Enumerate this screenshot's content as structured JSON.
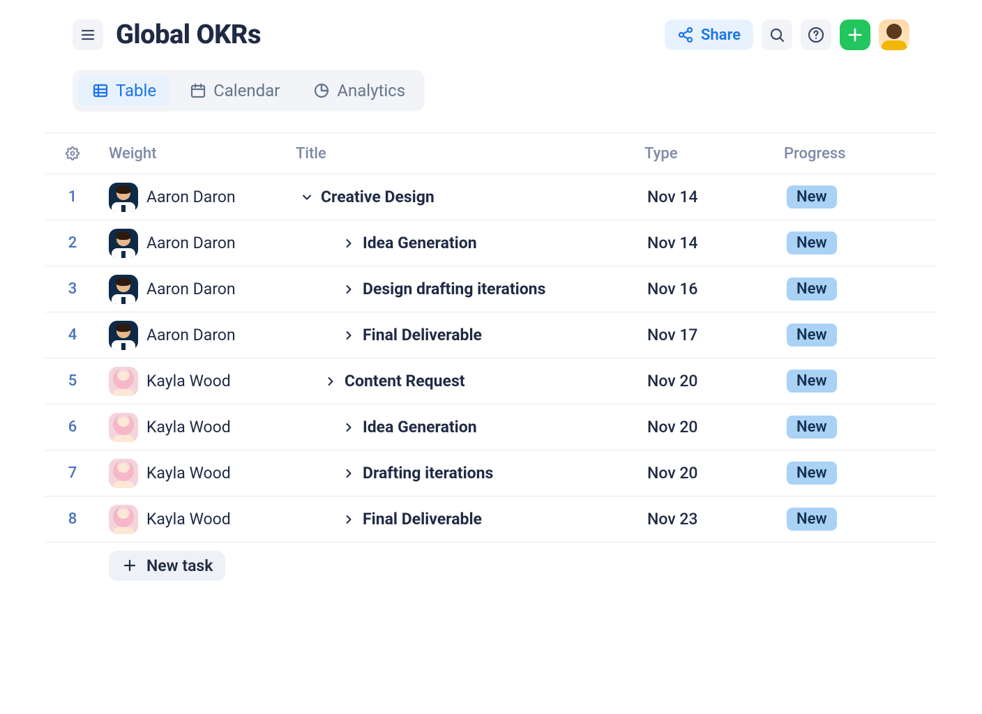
{
  "header": {
    "title": "Global OKRs",
    "share_label": "Share"
  },
  "tabs": [
    {
      "id": "table",
      "label": "Table",
      "icon": "table-icon",
      "active": true
    },
    {
      "id": "calendar",
      "label": "Calendar",
      "icon": "calendar-icon",
      "active": false
    },
    {
      "id": "analytics",
      "label": "Analytics",
      "icon": "analytics-icon",
      "active": false
    }
  ],
  "columns": {
    "weight": "Weight",
    "title": "Title",
    "type": "Type",
    "progress": "Progress"
  },
  "rows": [
    {
      "index": "1",
      "assignee": "Aaron Daron",
      "avatar": "aaron",
      "title": "Creative Design",
      "indent": 0,
      "chevron": "down",
      "type": "Nov 14",
      "progress": "New"
    },
    {
      "index": "2",
      "assignee": "Aaron Daron",
      "avatar": "aaron",
      "title": "Idea Generation",
      "indent": 2,
      "chevron": "right",
      "type": "Nov 14",
      "progress": "New"
    },
    {
      "index": "3",
      "assignee": "Aaron Daron",
      "avatar": "aaron",
      "title": "Design drafting iterations",
      "indent": 2,
      "chevron": "right",
      "type": "Nov 16",
      "progress": "New"
    },
    {
      "index": "4",
      "assignee": "Aaron Daron",
      "avatar": "aaron",
      "title": "Final Deliverable",
      "indent": 2,
      "chevron": "right",
      "type": "Nov 17",
      "progress": "New"
    },
    {
      "index": "5",
      "assignee": "Kayla Wood",
      "avatar": "kayla",
      "title": "Content Request",
      "indent": 1,
      "chevron": "right",
      "type": "Nov 20",
      "progress": "New"
    },
    {
      "index": "6",
      "assignee": "Kayla Wood",
      "avatar": "kayla",
      "title": "Idea Generation",
      "indent": 2,
      "chevron": "right",
      "type": "Nov 20",
      "progress": "New"
    },
    {
      "index": "7",
      "assignee": "Kayla Wood",
      "avatar": "kayla",
      "title": "Drafting iterations",
      "indent": 2,
      "chevron": "right",
      "type": "Nov 20",
      "progress": "New"
    },
    {
      "index": "8",
      "assignee": "Kayla Wood",
      "avatar": "kayla",
      "title": "Final Deliverable",
      "indent": 2,
      "chevron": "right",
      "type": "Nov 23",
      "progress": "New"
    }
  ],
  "new_task_label": "New task",
  "colors": {
    "accent_blue": "#1a73e8",
    "accent_green": "#22c55e",
    "badge_bg": "#a9d2f5"
  }
}
